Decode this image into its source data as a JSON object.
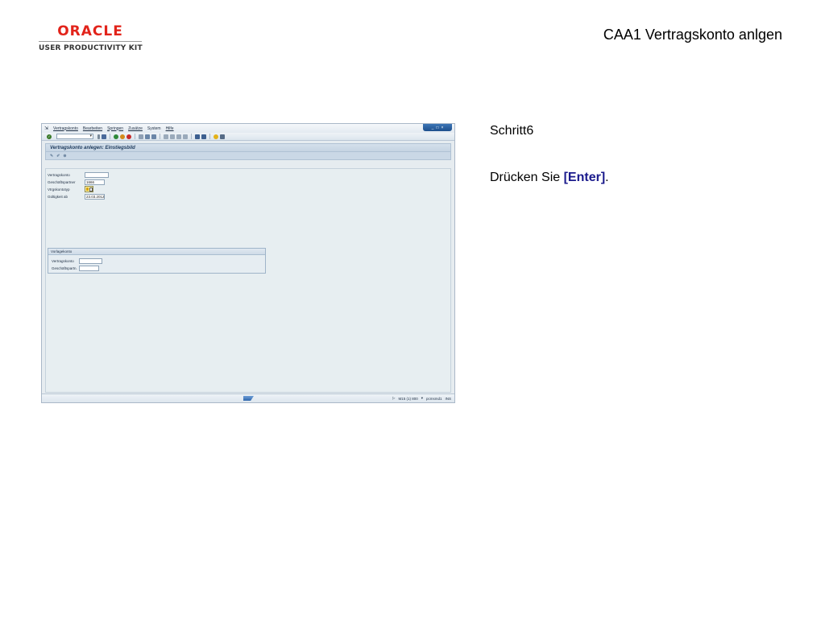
{
  "header": {
    "logo_brand": "ORACLE",
    "logo_product": "USER PRODUCTIVITY KIT",
    "title": "CAA1 Vertragskonto anlgen"
  },
  "instructions": {
    "step": "Schritt6",
    "prefix": "Drücken Sie ",
    "key": "[Enter]",
    "suffix": "."
  },
  "sap": {
    "menu": [
      "Vertragskonto",
      "Bearbeiten",
      "Springen",
      "Zusätze",
      "System",
      "Hilfe"
    ],
    "screen_title": "Vertragskonto anlegen: Einstiegsbild",
    "fields": {
      "vertragskonto_label": "Vertragskonto",
      "vertragskonto_value": "",
      "geschaeftspartner_label": "Geschäftspartner",
      "geschaeftspartner_value": "1666",
      "vtypkonto_label": "Vtrgskontotyp",
      "gueltig_label": "Gültigkeit ab",
      "gueltig_value": "23.03.2012"
    },
    "group": {
      "title": "Vorlagekonto",
      "vertragskonto_label": "Vertragskonto",
      "vertragskonto_value": "",
      "geschaeftspartn_label": "Geschäftspartn.",
      "geschaeftspartn_value": ""
    },
    "status": {
      "system": "M15 (1) 800",
      "server": "pcmsmd1",
      "mode": "INS"
    }
  }
}
